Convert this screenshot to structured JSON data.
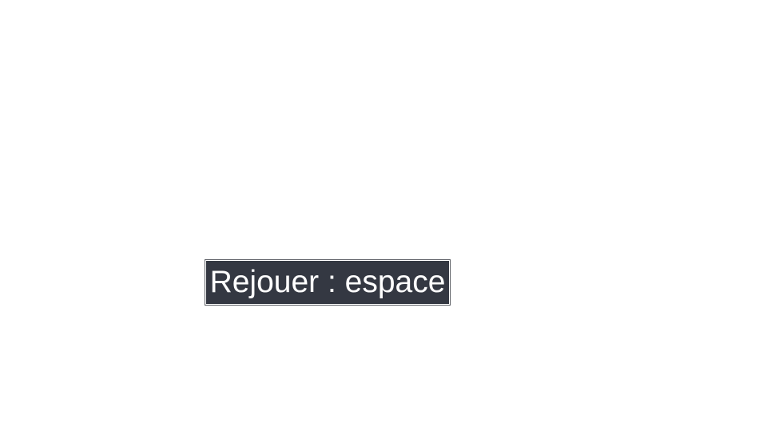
{
  "replay_prompt": {
    "label": "Rejouer : espace"
  },
  "colors": {
    "background": "#ffffff",
    "label_background": "#343842",
    "label_text": "#ffffff"
  }
}
